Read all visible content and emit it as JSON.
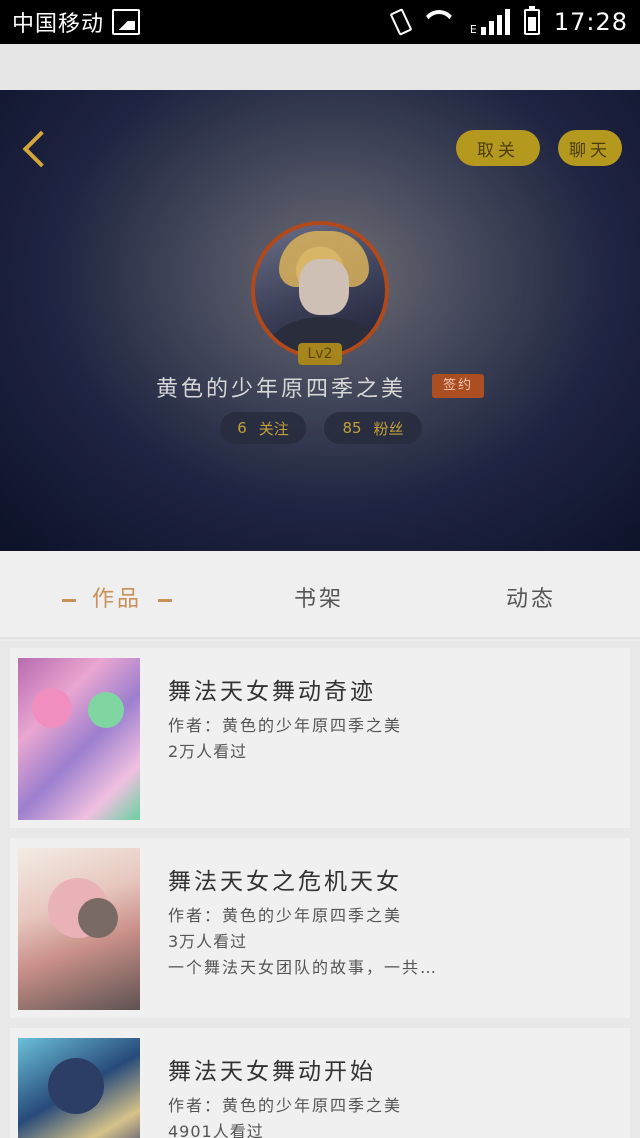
{
  "status_bar": {
    "carrier": "中国移动",
    "network": "E",
    "time": "17:28"
  },
  "profile": {
    "unfollow_label": "取关",
    "chat_label": "聊天",
    "level": "Lv2",
    "username": "黄色的少年原四季之美",
    "signed_badge": "签约",
    "following_count": "6",
    "following_label": "关注",
    "fans_count": "85",
    "fans_label": "粉丝"
  },
  "tabs": [
    {
      "label": "作品",
      "active": true
    },
    {
      "label": "书架",
      "active": false
    },
    {
      "label": "动态",
      "active": false
    }
  ],
  "works": [
    {
      "title": "舞法天女舞动奇迹",
      "author": "作者：黄色的少年原四季之美",
      "views": "2万人看过",
      "description": ""
    },
    {
      "title": "舞法天女之危机天女",
      "author": "作者：黄色的少年原四季之美",
      "views": "3万人看过",
      "description": "一个舞法天女团队的故事，一共…"
    },
    {
      "title": "舞法天女舞动开始",
      "author": "作者：黄色的少年原四季之美",
      "views": "4901人看过",
      "description": ""
    }
  ],
  "colors": {
    "accent": "#c8915a",
    "pill_yellow": "#b5991f",
    "signed_orange": "#ab4e22"
  }
}
